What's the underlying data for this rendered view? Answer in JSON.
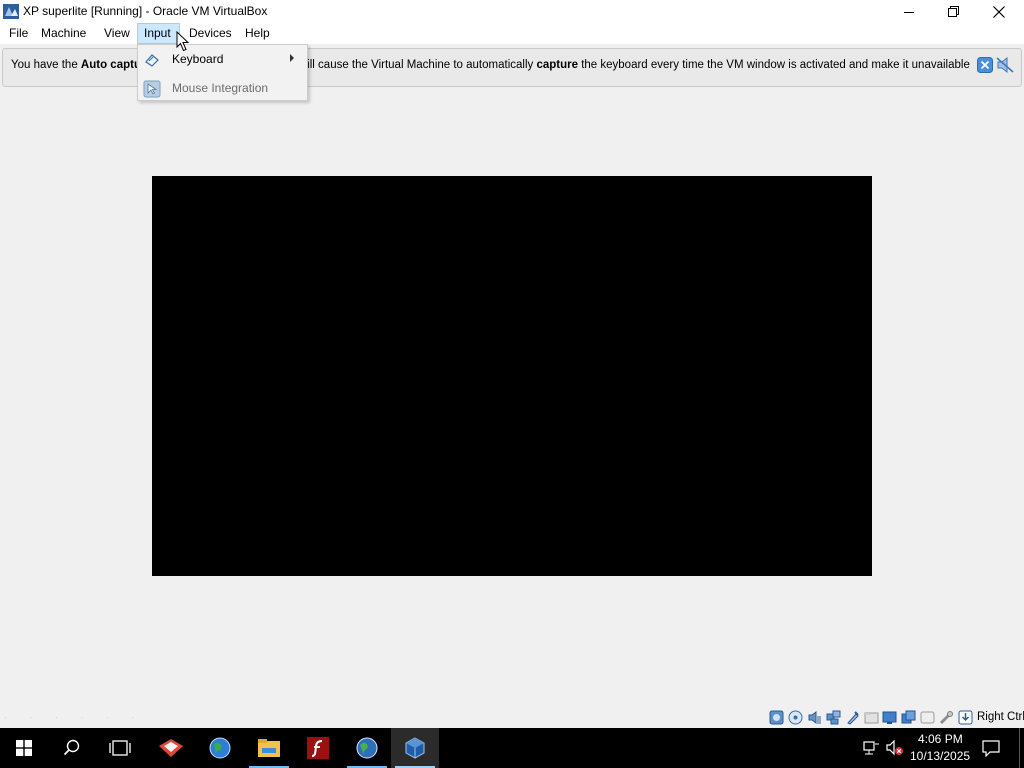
{
  "window": {
    "title": "XP superlite [Running] - Oracle VM VirtualBox"
  },
  "menubar": {
    "items": [
      "File",
      "Machine",
      "View",
      "Input",
      "Devices",
      "Help"
    ],
    "open_menu": "Input"
  },
  "notice": {
    "prefix": "You have the ",
    "bold1": "Auto captu",
    "middle": "his will cause the Virtual Machine to automatically ",
    "bold2": "capture",
    "suffix": " the keyboard every time the VM window is activated and make it unavailable to"
  },
  "input_menu": {
    "items": [
      {
        "label": "Keyboard",
        "has_submenu": true,
        "enabled": true
      },
      {
        "label": "Mouse Integration",
        "has_submenu": false,
        "enabled": false
      }
    ]
  },
  "statusbar": {
    "icons": [
      "hard-disk-icon",
      "optical-drive-icon",
      "audio-icon",
      "network-icon",
      "usb-icon",
      "shared-folders-icon",
      "display-icon",
      "recording-icon",
      "capture-icon",
      "cpu-icon",
      "mouse-integration-icon",
      "keyboard-icon"
    ],
    "host_key": "Right Ctrl"
  },
  "taskbar": {
    "apps": [
      "foxit-reader-icon",
      "browser-globe-icon",
      "file-explorer-icon",
      "flash-icon",
      "chrome-like-icon",
      "virtualbox-icon"
    ],
    "active_app": "virtualbox-icon",
    "time": "4:06 PM",
    "date": "10/13/2025"
  },
  "colors": {
    "menu_highlight": "#cce8ff",
    "taskbar": "#000000",
    "vm_screen": "#000000",
    "notice_bg": "#e9e9e9"
  }
}
